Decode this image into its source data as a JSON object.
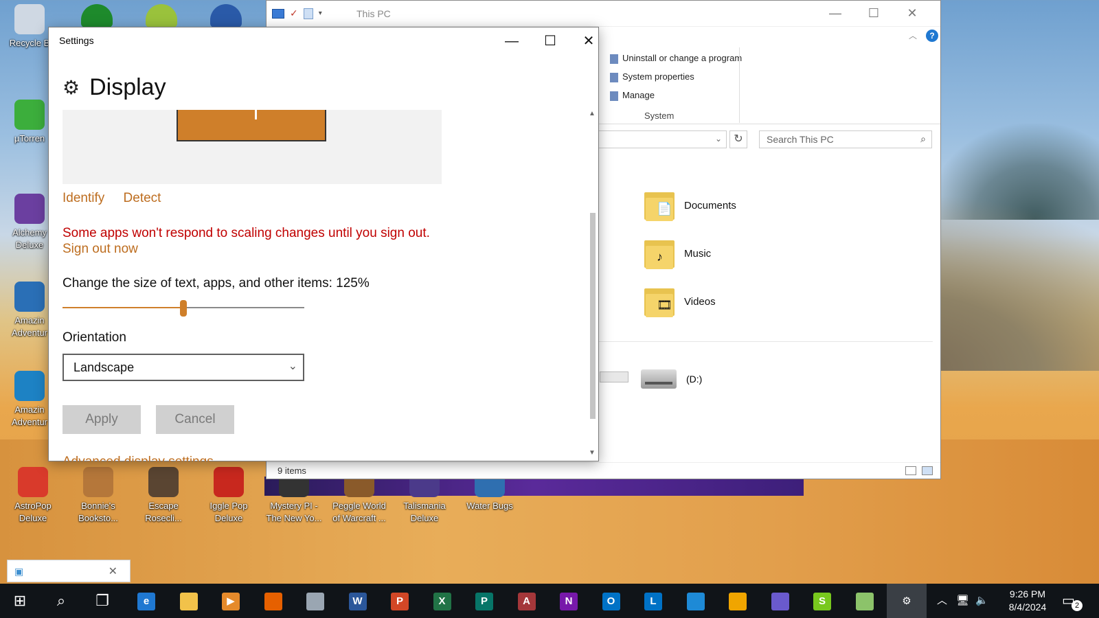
{
  "desktop": {
    "left_icons": [
      {
        "label": "Recycle B",
        "color": "#cfd8e3"
      },
      {
        "label": "µTorren",
        "color": "#3cae3c"
      },
      {
        "label": "Alchemy Deluxe",
        "color": "#6b3fa0"
      },
      {
        "label": "Amazin Adventur",
        "color": "#2a6fb6"
      },
      {
        "label": "Amazin Adventur",
        "color": "#1d82c4"
      }
    ],
    "top_icons": [
      {
        "color": "#1e8a2c"
      },
      {
        "color": "#9ac23c"
      },
      {
        "color": "#2a5aa8"
      }
    ],
    "bottom_icons": [
      {
        "label": "AstroPop Deluxe",
        "color": "#d93a2b"
      },
      {
        "label": "Bonnie's Booksto...",
        "color": "#b5773a"
      },
      {
        "label": "Escape Rosecli...",
        "color": "#5a4532"
      },
      {
        "label": "Iggle Pop Deluxe",
        "color": "#c8281e"
      },
      {
        "label": "Mystery PI - The New Yo...",
        "color": "#333333"
      },
      {
        "label": "Peggle World of Warcraft ...",
        "color": "#8a5a2a"
      },
      {
        "label": "Talismania Deluxe",
        "color": "#4b3a8a"
      },
      {
        "label": "Water Bugs",
        "color": "#2f6fb0"
      }
    ]
  },
  "explorer": {
    "title": "This PC",
    "ribbon_items": [
      "Uninstall or change a program",
      "System properties",
      "Manage"
    ],
    "ribbon_group": "System",
    "search_placeholder": "Search This PC",
    "folders": [
      {
        "name": "Documents",
        "icon": "documents-folder-icon",
        "badge": "📄"
      },
      {
        "name": "Music",
        "icon": "music-folder-icon",
        "badge": "♪"
      },
      {
        "name": "Videos",
        "icon": "videos-folder-icon",
        "badge": "🎞"
      }
    ],
    "drive_label": "(D:)",
    "status": "9 items"
  },
  "settings": {
    "window_title": "Settings",
    "page_title": "Display",
    "identify": "Identify",
    "detect": "Detect",
    "warning": "Some apps won't respond to scaling changes until you sign out.",
    "sign_out": "Sign out now",
    "scale_label": "Change the size of text, apps, and other items: 125%",
    "scale_slider_fraction": 0.5,
    "orientation_label": "Orientation",
    "orientation_value": "Landscape",
    "apply": "Apply",
    "cancel": "Cancel",
    "advanced_link": "Advanced display settings",
    "accent_color": "#cf7f2a",
    "warning_color": "#c00000"
  },
  "taskbar": {
    "apps": [
      {
        "name": "edge-icon",
        "glyph": "e",
        "color": "#1f78d1"
      },
      {
        "name": "file-explorer-icon",
        "glyph": "",
        "color": "#f2c24a"
      },
      {
        "name": "media-player-icon",
        "glyph": "▶",
        "color": "#e58a2b"
      },
      {
        "name": "firefox-icon",
        "glyph": "",
        "color": "#e66000"
      },
      {
        "name": "app-icon",
        "glyph": "",
        "color": "#9aa6b2"
      },
      {
        "name": "word-icon",
        "glyph": "W",
        "color": "#2b579a"
      },
      {
        "name": "powerpoint-icon",
        "glyph": "P",
        "color": "#d24726"
      },
      {
        "name": "excel-icon",
        "glyph": "X",
        "color": "#217346"
      },
      {
        "name": "publisher-icon",
        "glyph": "P",
        "color": "#077568"
      },
      {
        "name": "access-icon",
        "glyph": "A",
        "color": "#a4373a"
      },
      {
        "name": "onenote-icon",
        "glyph": "N",
        "color": "#7719aa"
      },
      {
        "name": "outlook-icon",
        "glyph": "O",
        "color": "#0072c6"
      },
      {
        "name": "lync-icon",
        "glyph": "L",
        "color": "#0072c6"
      },
      {
        "name": "vm-icon",
        "glyph": "",
        "color": "#1e8ad6"
      },
      {
        "name": "puzzle-icon",
        "glyph": "",
        "color": "#f0a500"
      },
      {
        "name": "bird-icon",
        "glyph": "",
        "color": "#6a5acd"
      },
      {
        "name": "sway-icon",
        "glyph": "S",
        "color": "#78c81e"
      },
      {
        "name": "recycle-icon",
        "glyph": "",
        "color": "#8cc36a"
      },
      {
        "name": "settings-icon",
        "glyph": "⚙",
        "color": "#3a3f45"
      }
    ],
    "time": "9:26 PM",
    "date": "8/4/2024",
    "notification_count": "2"
  }
}
